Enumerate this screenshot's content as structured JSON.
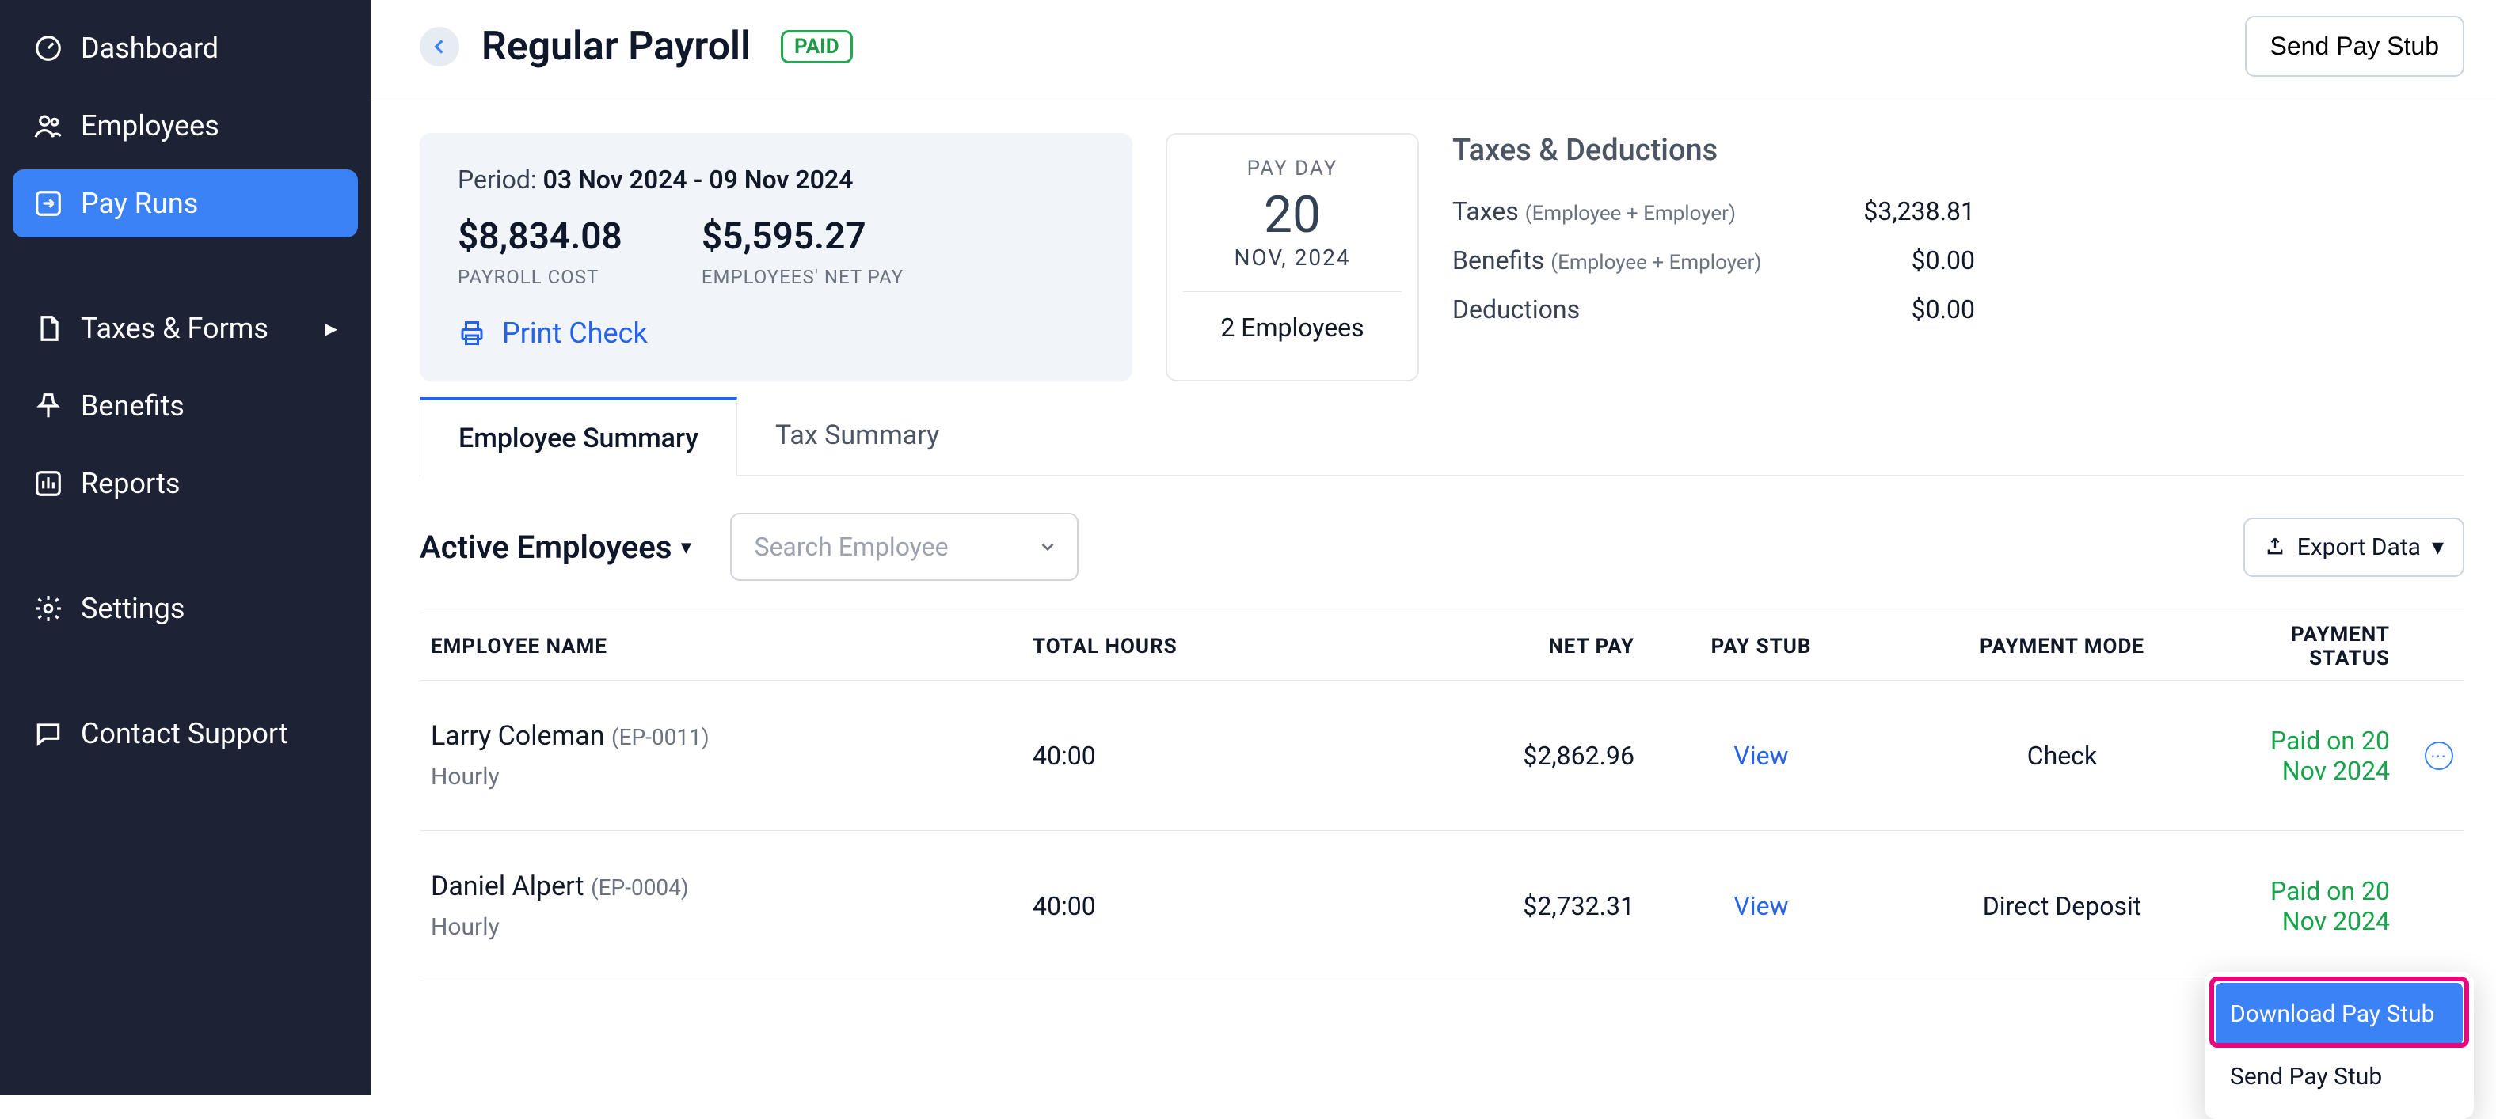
{
  "sidebar": {
    "items": [
      {
        "label": "Dashboard",
        "icon": "gauge",
        "active": false,
        "expand": false
      },
      {
        "label": "Employees",
        "icon": "users",
        "active": false,
        "expand": false
      },
      {
        "label": "Pay Runs",
        "icon": "arrow-square",
        "active": true,
        "expand": false
      },
      {
        "label": "Taxes & Forms",
        "icon": "doc",
        "active": false,
        "expand": true
      },
      {
        "label": "Benefits",
        "icon": "pin",
        "active": false,
        "expand": false
      },
      {
        "label": "Reports",
        "icon": "chart",
        "active": false,
        "expand": false
      },
      {
        "label": "Settings",
        "icon": "gear",
        "active": false,
        "expand": false
      },
      {
        "label": "Contact Support",
        "icon": "chat",
        "active": false,
        "expand": false
      }
    ]
  },
  "header": {
    "title": "Regular Payroll",
    "badge": "PAID",
    "send_button": "Send Pay Stub"
  },
  "summary": {
    "period_prefix": "Period: ",
    "period_range": "03 Nov 2024 - 09 Nov 2024",
    "payroll_cost_amount": "$8,834.08",
    "payroll_cost_label": "PAYROLL COST",
    "net_pay_amount": "$5,595.27",
    "net_pay_label": "EMPLOYEES' NET PAY",
    "print_check": "Print Check"
  },
  "payday": {
    "label": "PAY DAY",
    "day": "20",
    "month": "NOV, 2024",
    "employees": "2 Employees"
  },
  "taxes": {
    "heading": "Taxes & Deductions",
    "rows": [
      {
        "name": "Taxes",
        "paren": "(Employee + Employer)",
        "value": "$3,238.81"
      },
      {
        "name": "Benefits",
        "paren": "(Employee + Employer)",
        "value": "$0.00"
      },
      {
        "name": "Deductions",
        "paren": "",
        "value": "$0.00"
      }
    ]
  },
  "tabs": {
    "items": [
      {
        "label": "Employee Summary",
        "active": true
      },
      {
        "label": "Tax Summary",
        "active": false
      }
    ]
  },
  "filters": {
    "dropdown_label": "Active Employees",
    "search_placeholder": "Search Employee",
    "export_label": "Export Data"
  },
  "table": {
    "columns": [
      "EMPLOYEE NAME",
      "TOTAL HOURS",
      "NET PAY",
      "PAY STUB",
      "PAYMENT MODE",
      "PAYMENT STATUS"
    ],
    "rows": [
      {
        "name": "Larry Coleman",
        "id": "(EP-0011)",
        "type": "Hourly",
        "hours": "40:00",
        "net": "$2,862.96",
        "stub": "View",
        "mode": "Check",
        "status": "Paid on 20 Nov 2024"
      },
      {
        "name": "Daniel Alpert",
        "id": "(EP-0004)",
        "type": "Hourly",
        "hours": "40:00",
        "net": "$2,732.31",
        "stub": "View",
        "mode": "Direct Deposit",
        "status": "Paid on 20 Nov 2024"
      }
    ]
  },
  "popup": {
    "items": [
      {
        "label": "Download Pay Stub",
        "active": true
      },
      {
        "label": "Send Pay Stub",
        "active": false
      }
    ]
  }
}
